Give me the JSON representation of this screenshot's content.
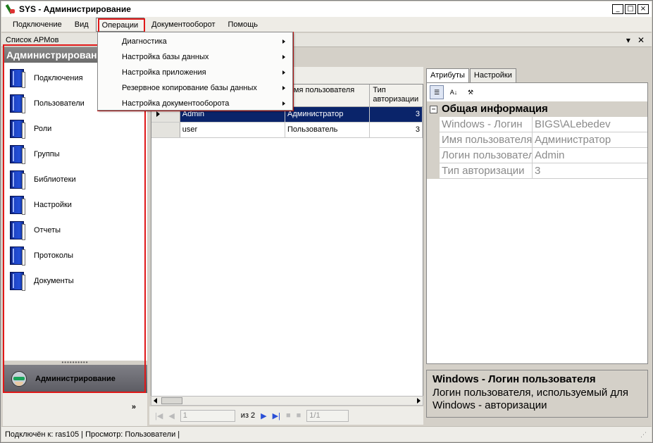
{
  "window": {
    "title": "SYS - Администрирование",
    "controls": {
      "minimize": "_",
      "maximize": "□",
      "close": "×"
    }
  },
  "menubar": {
    "items": [
      "Подключение",
      "Вид",
      "Операции",
      "Документооборот",
      "Помощь"
    ]
  },
  "operations_menu": {
    "items": [
      "Диагностика",
      "Настройка базы данных",
      "Настройка приложения",
      "Резервное копирование базы данных",
      "Настройка документооборота"
    ]
  },
  "left_pane": {
    "header": "Список АРМов",
    "title": "Администрирование",
    "items": [
      "Подключения",
      "Пользователи",
      "Роли",
      "Группы",
      "Библиотеки",
      "Настройки",
      "Отчеты",
      "Протоколы",
      "Документы"
    ],
    "active_section": "Администрирование",
    "more": "»"
  },
  "pane_controls": {
    "dropdown": "▾",
    "close": "✕"
  },
  "grid": {
    "columns": [
      "",
      "",
      "Имя пользователя",
      "Тип авторизации"
    ],
    "rows": [
      {
        "login": "Admin",
        "name": "Администратор",
        "auth": "3",
        "selected": true
      },
      {
        "login": "user",
        "name": "Пользователь",
        "auth": "3",
        "selected": false
      }
    ]
  },
  "pager": {
    "current": "1",
    "of_label": "из 2",
    "record": "1/1"
  },
  "right_pane": {
    "tabs": [
      "Атрибуты",
      "Настройки"
    ],
    "category": "Общая информация",
    "properties": [
      {
        "key": "Windows - Логин",
        "value": "BIGS\\ALebedev"
      },
      {
        "key": "Имя пользователя",
        "value": "Администратор"
      },
      {
        "key": "Логин пользователя",
        "value": "Admin"
      },
      {
        "key": "Тип авторизации",
        "value": "3"
      }
    ],
    "description_title": "Windows - Логин пользователя",
    "description_text": "Логин пользователя, используемый для Windows - авторизации"
  },
  "statusbar": {
    "text": "Подключён к: ras105 | Просмотр: Пользователи |"
  },
  "colors": {
    "selection": "#0a246a",
    "highlight_outline": "#e01818",
    "left_title_bg": "#6c6c6c"
  }
}
